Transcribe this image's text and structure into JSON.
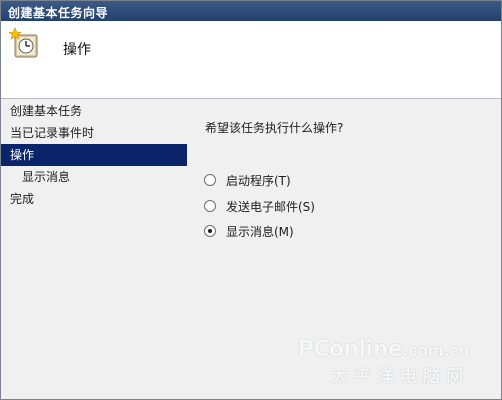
{
  "window": {
    "title": "创建基本任务向导"
  },
  "header": {
    "title": "操作",
    "icon": "task-clock-icon"
  },
  "sidebar": {
    "items": [
      {
        "label": "创建基本任务",
        "level": 0,
        "active": false
      },
      {
        "label": "当已记录事件时",
        "level": 0,
        "active": false
      },
      {
        "label": "操作",
        "level": 0,
        "active": true
      },
      {
        "label": "显示消息",
        "level": 1,
        "active": false
      },
      {
        "label": "完成",
        "level": 0,
        "active": false
      }
    ]
  },
  "content": {
    "question": "希望该任务执行什么操作?",
    "options": [
      {
        "label": "启动程序(T)",
        "checked": false
      },
      {
        "label": "发送电子邮件(S)",
        "checked": false
      },
      {
        "label": "显示消息(M)",
        "checked": true
      }
    ]
  },
  "watermark": {
    "brand": "PConline",
    "domain": ".com.cn",
    "sub": "太平洋电脑网"
  },
  "colors": {
    "titlebar": "#24416d",
    "selection": "#0a246a",
    "panel": "#f0f0f0"
  }
}
